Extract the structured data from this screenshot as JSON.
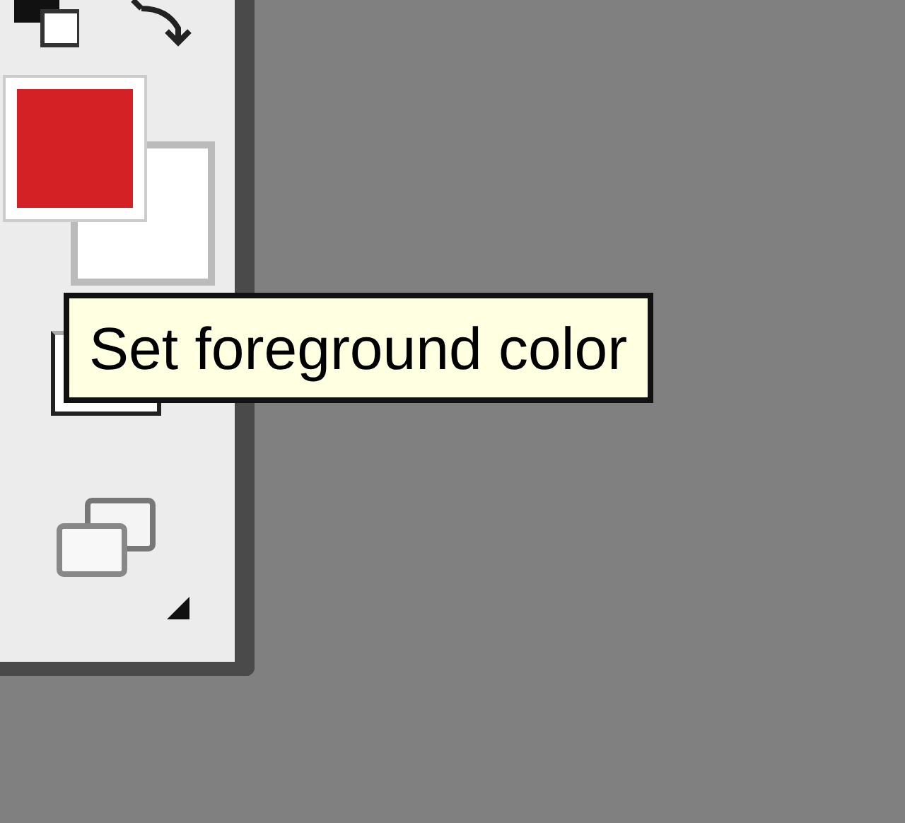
{
  "swatches": [
    {
      "kind": "background",
      "color": "#ffffff"
    },
    {
      "kind": "foreground",
      "color": "#d42125"
    }
  ],
  "tooltip": {
    "text": "Set foreground color"
  }
}
